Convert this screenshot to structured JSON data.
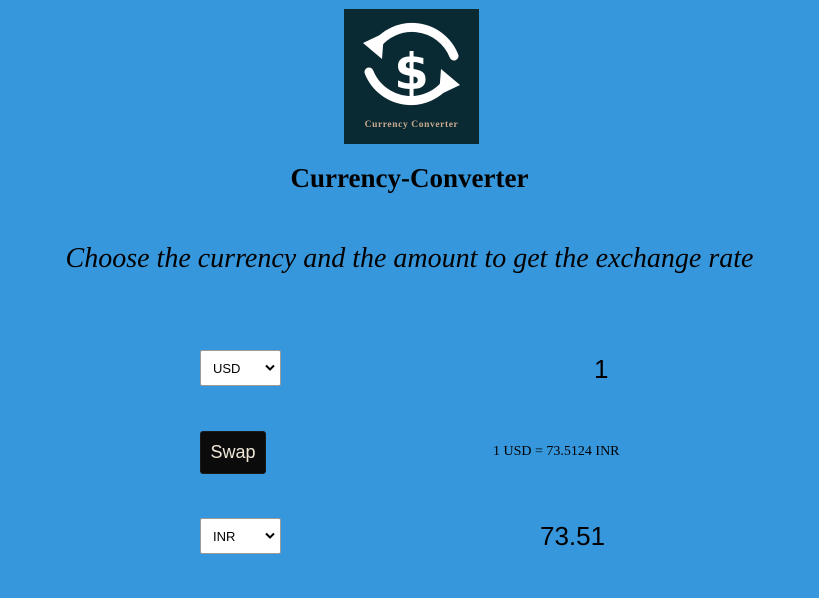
{
  "logo": {
    "icon": "currency-exchange-icon",
    "caption": "Currency Converter",
    "background_color": "#0a2a33",
    "caption_color": "#c9a98f"
  },
  "title": "Currency-Converter",
  "subtitle": "Choose the currency and the amount to get the exchange rate",
  "from": {
    "currency": "USD",
    "amount": "1"
  },
  "swap_label": "Swap",
  "rate_text": "1 USD = 73.5124 INR",
  "to": {
    "currency": "INR",
    "amount": "73.51"
  },
  "colors": {
    "page_background": "#3797dc",
    "button_background": "#0b0b0b"
  }
}
